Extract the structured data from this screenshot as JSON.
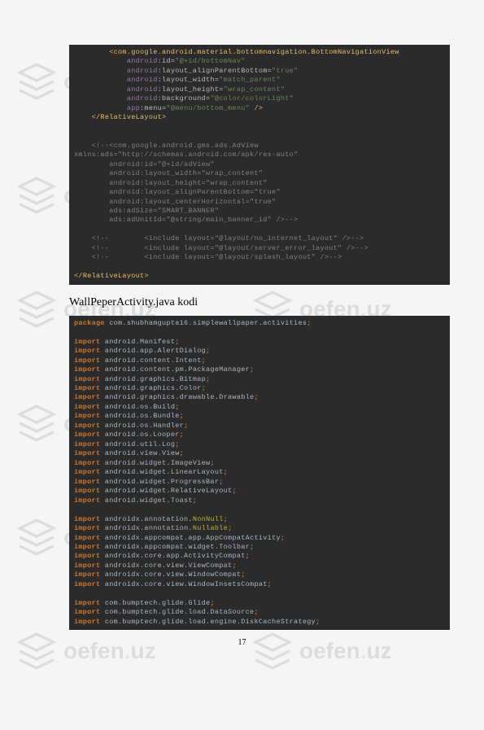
{
  "watermark": {
    "brand_pre": "oefen",
    "brand_dot": ".",
    "brand_post": "uz"
  },
  "code1": {
    "l1": {
      "indent": "        ",
      "tag_open": "<",
      "tag": "com.google.android.material.bottomnavigation.BottomNavigationView"
    },
    "l2": {
      "indent": "            ",
      "ns": "android",
      "attr": ":id=",
      "val": "\"@+id/bottomNav\""
    },
    "l3": {
      "indent": "            ",
      "ns": "android",
      "attr": ":layout_alignParentBottom=",
      "val": "\"true\""
    },
    "l4": {
      "indent": "            ",
      "ns": "android",
      "attr": ":layout_width=",
      "val": "\"match_parent\""
    },
    "l5": {
      "indent": "            ",
      "ns": "android",
      "attr": ":layout_height=",
      "val": "\"wrap_content\""
    },
    "l6": {
      "indent": "            ",
      "ns": "android",
      "attr": ":background=",
      "val": "\"@color/colorLight\""
    },
    "l7": {
      "indent": "            ",
      "ns": "app",
      "attr": ":menu=",
      "val": "\"@menu/bottom_menu\"",
      "close": " />"
    },
    "l8": {
      "indent": "    ",
      "tag_open": "</",
      "tag": "RelativeLayout",
      "tag_close": ">"
    },
    "l9": "",
    "l10": "",
    "l11": {
      "indent": "    ",
      "comment": "<!--<com.google.android.gms.ads.AdView"
    },
    "l12": {
      "comment": "xmlns:ads=\"http://schemas.android.com/apk/res-auto\""
    },
    "l13": {
      "indent": "        ",
      "comment": "android:id=\"@+id/adView\""
    },
    "l14": {
      "indent": "        ",
      "comment": "android:layout_width=\"wrap_content\""
    },
    "l15": {
      "indent": "        ",
      "comment": "android:layout_height=\"wrap_content\""
    },
    "l16": {
      "indent": "        ",
      "comment": "android:layout_alignParentBottom=\"true\""
    },
    "l17": {
      "indent": "        ",
      "comment": "android:layout_centerHorizontal=\"true\""
    },
    "l18": {
      "indent": "        ",
      "comment": "ads:adSize=\"SMART_BANNER\""
    },
    "l19": {
      "indent": "        ",
      "comment": "ads:adUnitId=\"@string/main_banner_id\" />-->"
    },
    "l20": "",
    "l21": {
      "indent": "    ",
      "comment": "<!--        <include layout=\"@layout/no_internet_layout\" />-->"
    },
    "l22": {
      "indent": "    ",
      "comment": "<!--        <include layout=\"@layout/server_error_layout\" />-->"
    },
    "l23": {
      "indent": "    ",
      "comment": "<!--        <include layout=\"@layout/splash_layout\" />-->"
    },
    "l24": "",
    "l25": {
      "tag_open": "</",
      "tag": "RelativeLayout",
      "tag_close": ">"
    }
  },
  "section_title": "WallPeperActivity.java kodi",
  "code2": {
    "l1": {
      "kw": "package ",
      "pkg": "com.shubhamgupta16.simplewallpaper.activities",
      "semi": ";"
    },
    "l2": "",
    "l3": {
      "kw": "import ",
      "pkg": "android.Manifest",
      "semi": ";"
    },
    "l4": {
      "kw": "import ",
      "pkg": "android.app.AlertDialog",
      "semi": ";"
    },
    "l5": {
      "kw": "import ",
      "pkg": "android.content.Intent",
      "semi": ";"
    },
    "l6": {
      "kw": "import ",
      "pkg": "android.content.pm.PackageManager",
      "semi": ";"
    },
    "l7": {
      "kw": "import ",
      "pkg": "android.graphics.Bitmap",
      "semi": ";"
    },
    "l8": {
      "kw": "import ",
      "pkg": "android.graphics.Color",
      "semi": ";"
    },
    "l9": {
      "kw": "import ",
      "pkg": "android.graphics.drawable.Drawable",
      "semi": ";"
    },
    "l10": {
      "kw": "import ",
      "pkg": "android.os.Build",
      "semi": ";"
    },
    "l11": {
      "kw": "import ",
      "pkg": "android.os.Bundle",
      "semi": ";"
    },
    "l12": {
      "kw": "import ",
      "pkg": "android.os.Handler",
      "semi": ";"
    },
    "l13": {
      "kw": "import ",
      "pkg": "android.os.Looper",
      "semi": ";"
    },
    "l14": {
      "kw": "import ",
      "pkg": "android.util.Log",
      "semi": ";"
    },
    "l15": {
      "kw": "import ",
      "pkg": "android.view.View",
      "semi": ";"
    },
    "l16": {
      "kw": "import ",
      "pkg": "android.widget.ImageView",
      "semi": ";"
    },
    "l17": {
      "kw": "import ",
      "pkg": "android.widget.LinearLayout",
      "semi": ";"
    },
    "l18": {
      "kw": "import ",
      "pkg": "android.widget.ProgressBar",
      "semi": ";"
    },
    "l19": {
      "kw": "import ",
      "pkg": "android.widget.RelativeLayout",
      "semi": ";"
    },
    "l20": {
      "kw": "import ",
      "pkg": "android.widget.Toast",
      "semi": ";"
    },
    "l21": "",
    "l22": {
      "kw": "import ",
      "pkg": "androidx.annotation.",
      "nn": "NonNull",
      "semi": ";"
    },
    "l23": {
      "kw": "import ",
      "pkg": "androidx.annotation.",
      "nn": "Nullable",
      "semi": ";"
    },
    "l24": {
      "kw": "import ",
      "pkg": "androidx.appcompat.app.AppCompatActivity",
      "semi": ";"
    },
    "l25": {
      "kw": "import ",
      "pkg": "androidx.appcompat.widget.Toolbar",
      "semi": ";"
    },
    "l26": {
      "kw": "import ",
      "pkg": "androidx.core.app.ActivityCompat",
      "semi": ";"
    },
    "l27": {
      "kw": "import ",
      "pkg": "androidx.core.view.ViewCompat",
      "semi": ";"
    },
    "l28": {
      "kw": "import ",
      "pkg": "androidx.core.view.WindowCompat",
      "semi": ";"
    },
    "l29": {
      "kw": "import ",
      "pkg": "androidx.core.view.WindowInsetsCompat",
      "semi": ";"
    },
    "l30": "",
    "l31": {
      "kw": "import ",
      "pkg": "com.bumptech.glide.Glide",
      "semi": ";"
    },
    "l32": {
      "kw": "import ",
      "pkg": "com.bumptech.glide.load.DataSource",
      "semi": ";"
    },
    "l33": {
      "kw": "import ",
      "pkg": "com.bumptech.glide.load.engine.DiskCacheStrategy",
      "semi": ";"
    }
  },
  "page_number": "17"
}
